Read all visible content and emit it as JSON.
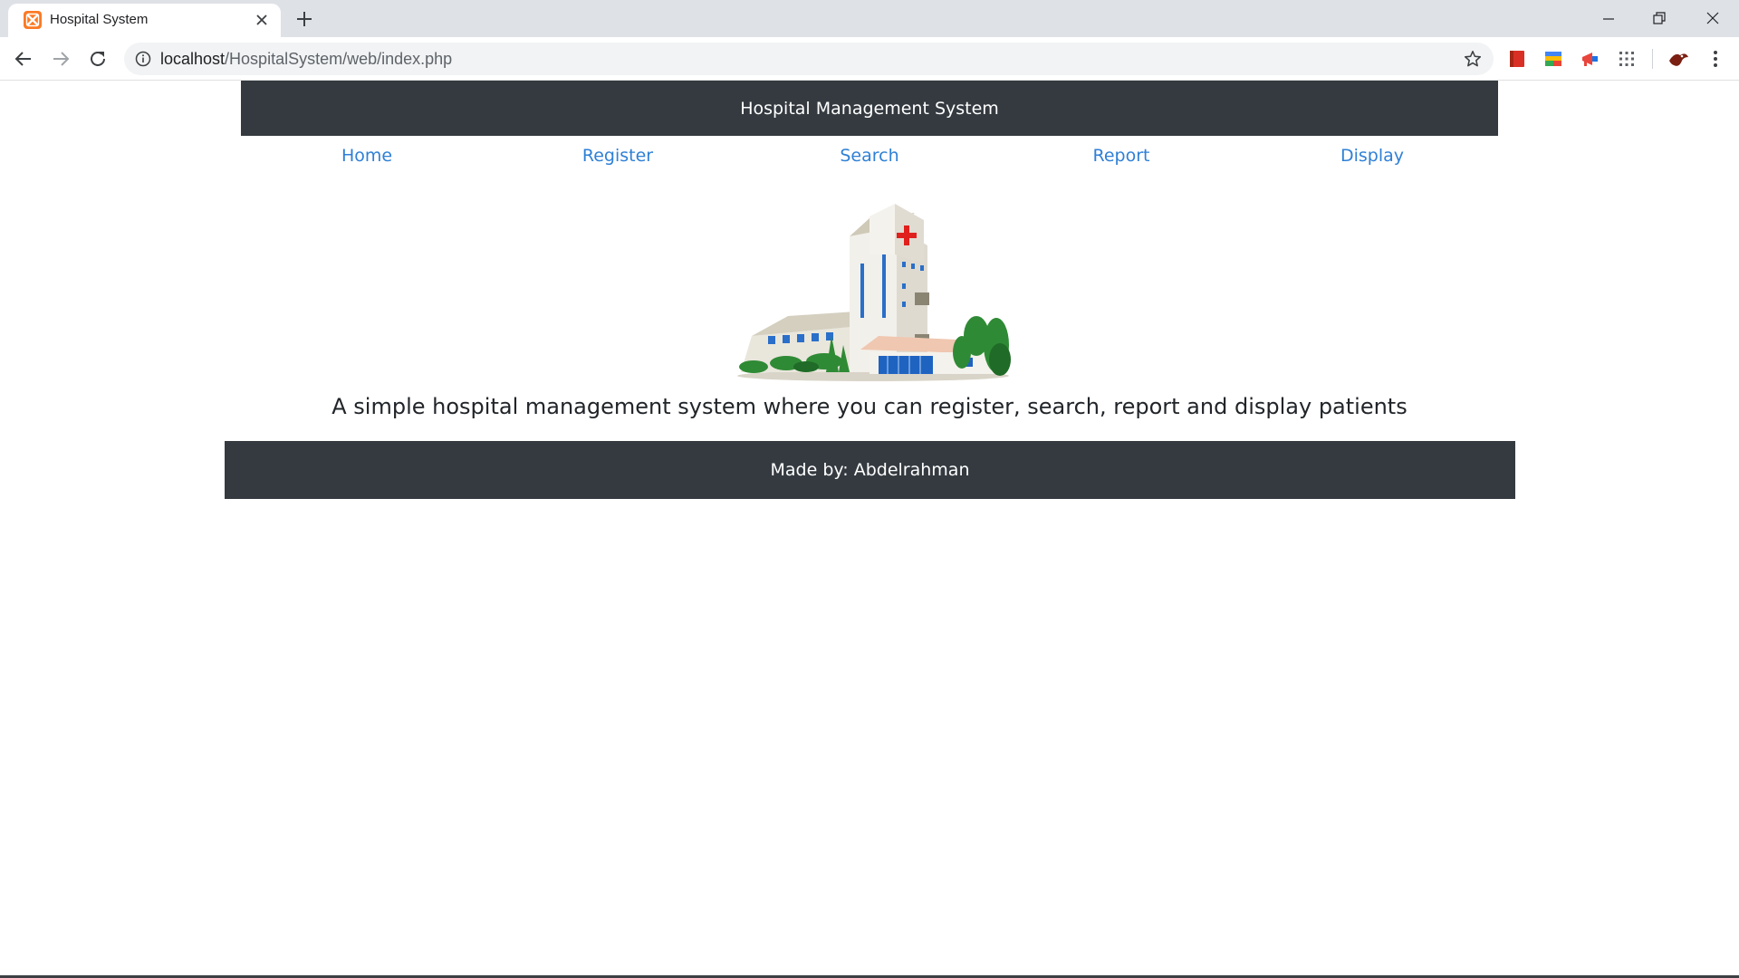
{
  "browser": {
    "tab_title": "Hospital System",
    "url_host": "localhost",
    "url_path": "/HospitalSystem/web/index.php"
  },
  "page": {
    "header_title": "Hospital Management System",
    "nav": [
      {
        "label": "Home"
      },
      {
        "label": "Register"
      },
      {
        "label": "Search"
      },
      {
        "label": "Report"
      },
      {
        "label": "Display"
      }
    ],
    "tagline": "A simple hospital management system where you can register, search, report and display patients",
    "footer_text": "Made by: Abdelrahman"
  },
  "icons": {
    "favicon": "xampp-icon",
    "back": "arrow-left-icon",
    "forward": "arrow-right-icon",
    "reload": "reload-icon",
    "info": "info-icon",
    "bookmark": "star-icon",
    "menu": "kebab-menu-icon"
  },
  "colors": {
    "navbar_bg": "#343a40",
    "link": "#2f80d6",
    "tab_strip": "#dee1e6"
  }
}
